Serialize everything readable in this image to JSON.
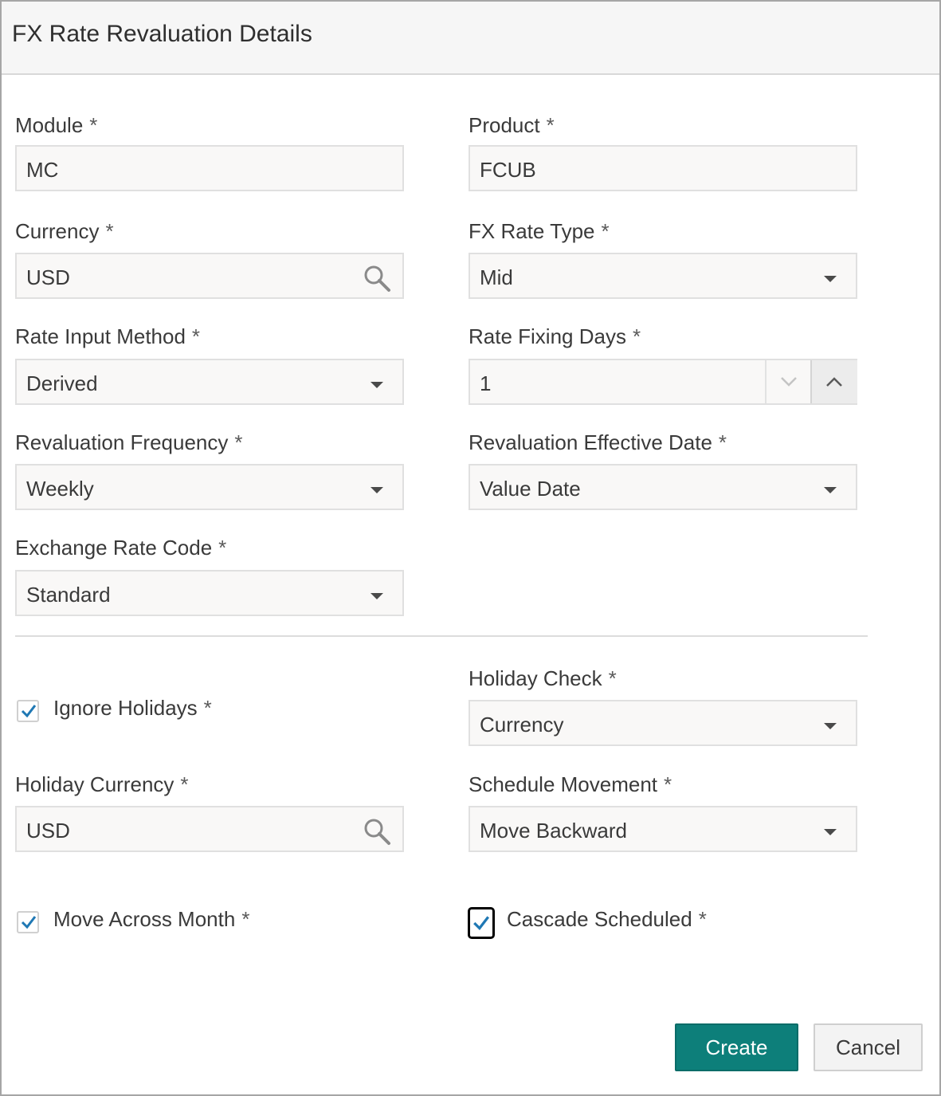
{
  "dialog": {
    "title": "FX Rate Revaluation Details"
  },
  "required_marker": "*",
  "fields": {
    "module": {
      "label": "Module",
      "value": "MC"
    },
    "product": {
      "label": "Product",
      "value": "FCUB"
    },
    "currency": {
      "label": "Currency",
      "value": "USD",
      "icon": "search-icon"
    },
    "fx_rate_type": {
      "label": "FX Rate Type",
      "value": "Mid"
    },
    "rate_input_method": {
      "label": "Rate Input Method",
      "value": "Derived"
    },
    "rate_fixing_days": {
      "label": "Rate Fixing Days",
      "value": "1"
    },
    "revaluation_frequency": {
      "label": "Revaluation Frequency",
      "value": "Weekly"
    },
    "revaluation_effective_date": {
      "label": "Revaluation Effective Date",
      "value": "Value Date"
    },
    "exchange_rate_code": {
      "label": "Exchange Rate Code",
      "value": "Standard"
    },
    "ignore_holidays": {
      "label": "Ignore Holidays",
      "checked": true
    },
    "holiday_check": {
      "label": "Holiday Check",
      "value": "Currency"
    },
    "holiday_currency": {
      "label": "Holiday Currency",
      "value": "USD",
      "icon": "search-icon"
    },
    "schedule_movement": {
      "label": "Schedule Movement",
      "value": "Move Backward"
    },
    "move_across_month": {
      "label": "Move Across Month",
      "checked": true
    },
    "cascade_scheduled": {
      "label": "Cascade Scheduled",
      "checked": true
    }
  },
  "buttons": {
    "create": "Create",
    "cancel": "Cancel"
  },
  "colors": {
    "primary_button": "#0d7f7a",
    "checkmark": "#1f78b4"
  }
}
